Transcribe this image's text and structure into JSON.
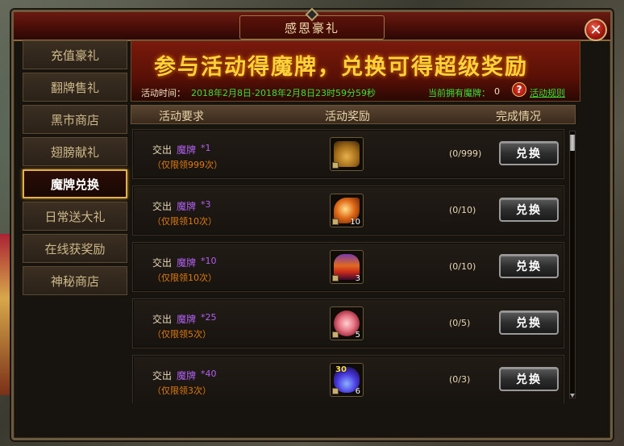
{
  "window": {
    "title": "感恩豪礼"
  },
  "sidebar": {
    "items": [
      {
        "label": "充值豪礼"
      },
      {
        "label": "翻牌售礼"
      },
      {
        "label": "黑市商店"
      },
      {
        "label": "翅膀献礼"
      },
      {
        "label": "魔牌兑换",
        "active": true
      },
      {
        "label": "日常送大礼"
      },
      {
        "label": "在线获奖励"
      },
      {
        "label": "神秘商店"
      }
    ]
  },
  "banner": {
    "headline": "参与活动得魔牌，兑换可得超级奖励",
    "time_label": "活动时间：",
    "time_value": "2018年2月8日-2018年2月8日23时59分59秒",
    "owned_label": "当前拥有魔牌：",
    "owned_value": "0",
    "rules_link": "活动规则"
  },
  "table": {
    "headers": [
      "活动要求",
      "活动奖励",
      "完成情况"
    ],
    "button_label": "兑换",
    "rows": [
      {
        "prefix": "交出",
        "item": "魔牌",
        "count": "*1",
        "limit": "（仅限领999次）",
        "reward_icon": "money-bag-icon",
        "reward_qty": "",
        "progress": "(0/999)"
      },
      {
        "prefix": "交出",
        "item": "魔牌",
        "count": "*3",
        "limit": "（仅限领10次）",
        "reward_icon": "feather-icon",
        "reward_qty": "10",
        "progress": "(0/10)"
      },
      {
        "prefix": "交出",
        "item": "魔牌",
        "count": "*10",
        "limit": "（仅限领10次）",
        "reward_icon": "potion-icon",
        "reward_qty": "3",
        "progress": "(0/10)"
      },
      {
        "prefix": "交出",
        "item": "魔牌",
        "count": "*25",
        "limit": "（仅限领5次）",
        "reward_icon": "flower-icon",
        "reward_qty": "5",
        "progress": "(0/5)"
      },
      {
        "prefix": "交出",
        "item": "魔牌",
        "count": "*40",
        "limit": "（仅限领3次）",
        "reward_icon": "gem-icon",
        "reward_qty": "6",
        "progress": "(0/3)",
        "reward_badge": "30"
      }
    ]
  },
  "colors": {
    "accent_gold": "#ffd23a",
    "green_text": "#3ae03a",
    "purple_item": "#b060f0",
    "orange_limit": "#e07a10"
  }
}
